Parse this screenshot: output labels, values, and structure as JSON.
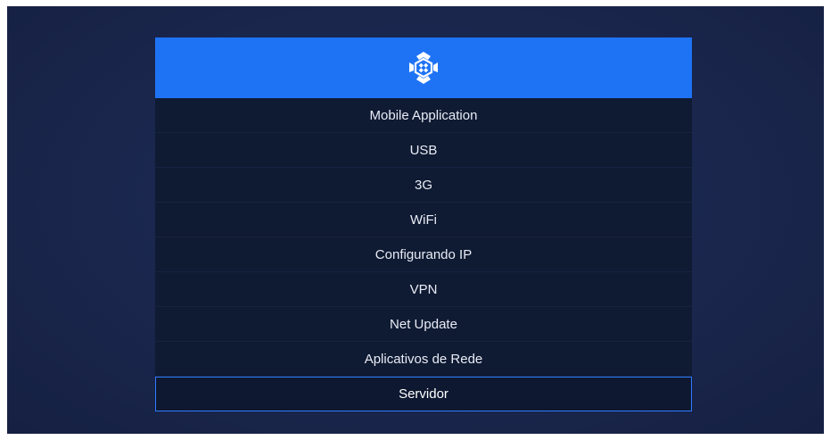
{
  "header": {
    "logo_icon": "network-logo-icon",
    "accent_color": "#1e73f5"
  },
  "menu": {
    "selected_index": 8,
    "items": [
      {
        "label": "Mobile Application"
      },
      {
        "label": "USB"
      },
      {
        "label": "3G"
      },
      {
        "label": "WiFi"
      },
      {
        "label": "Configurando IP"
      },
      {
        "label": "VPN"
      },
      {
        "label": "Net Update"
      },
      {
        "label": "Aplicativos de Rede"
      },
      {
        "label": "Servidor"
      }
    ]
  }
}
